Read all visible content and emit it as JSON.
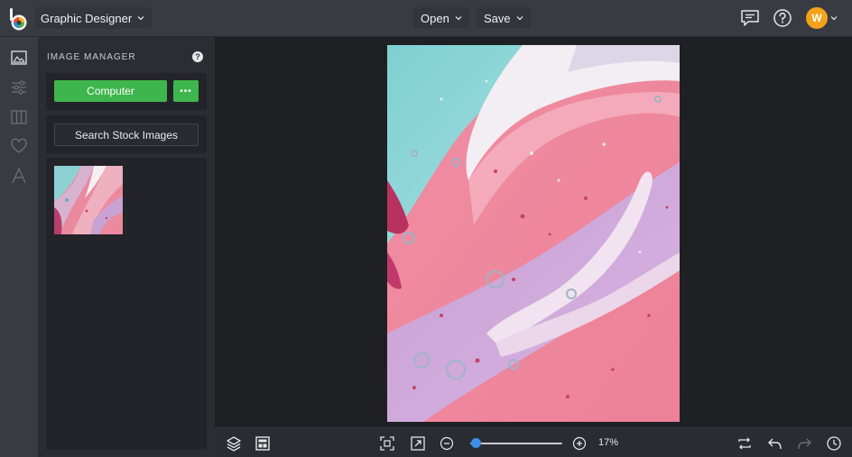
{
  "app": {
    "mode_label": "Graphic Designer",
    "menus": {
      "open_label": "Open",
      "save_label": "Save"
    },
    "user_initial": "W",
    "accent_color": "#3fb54d"
  },
  "panel": {
    "title": "IMAGE MANAGER",
    "help_label": "?",
    "computer_button": "Computer",
    "more_button": "•••",
    "stock_button": "Search Stock Images"
  },
  "rail": [
    "image-icon",
    "sliders-icon",
    "columns-icon",
    "heart-icon",
    "text-icon"
  ],
  "toolbar": {
    "zoom_text": "17%",
    "zoom_level": 0.06
  }
}
